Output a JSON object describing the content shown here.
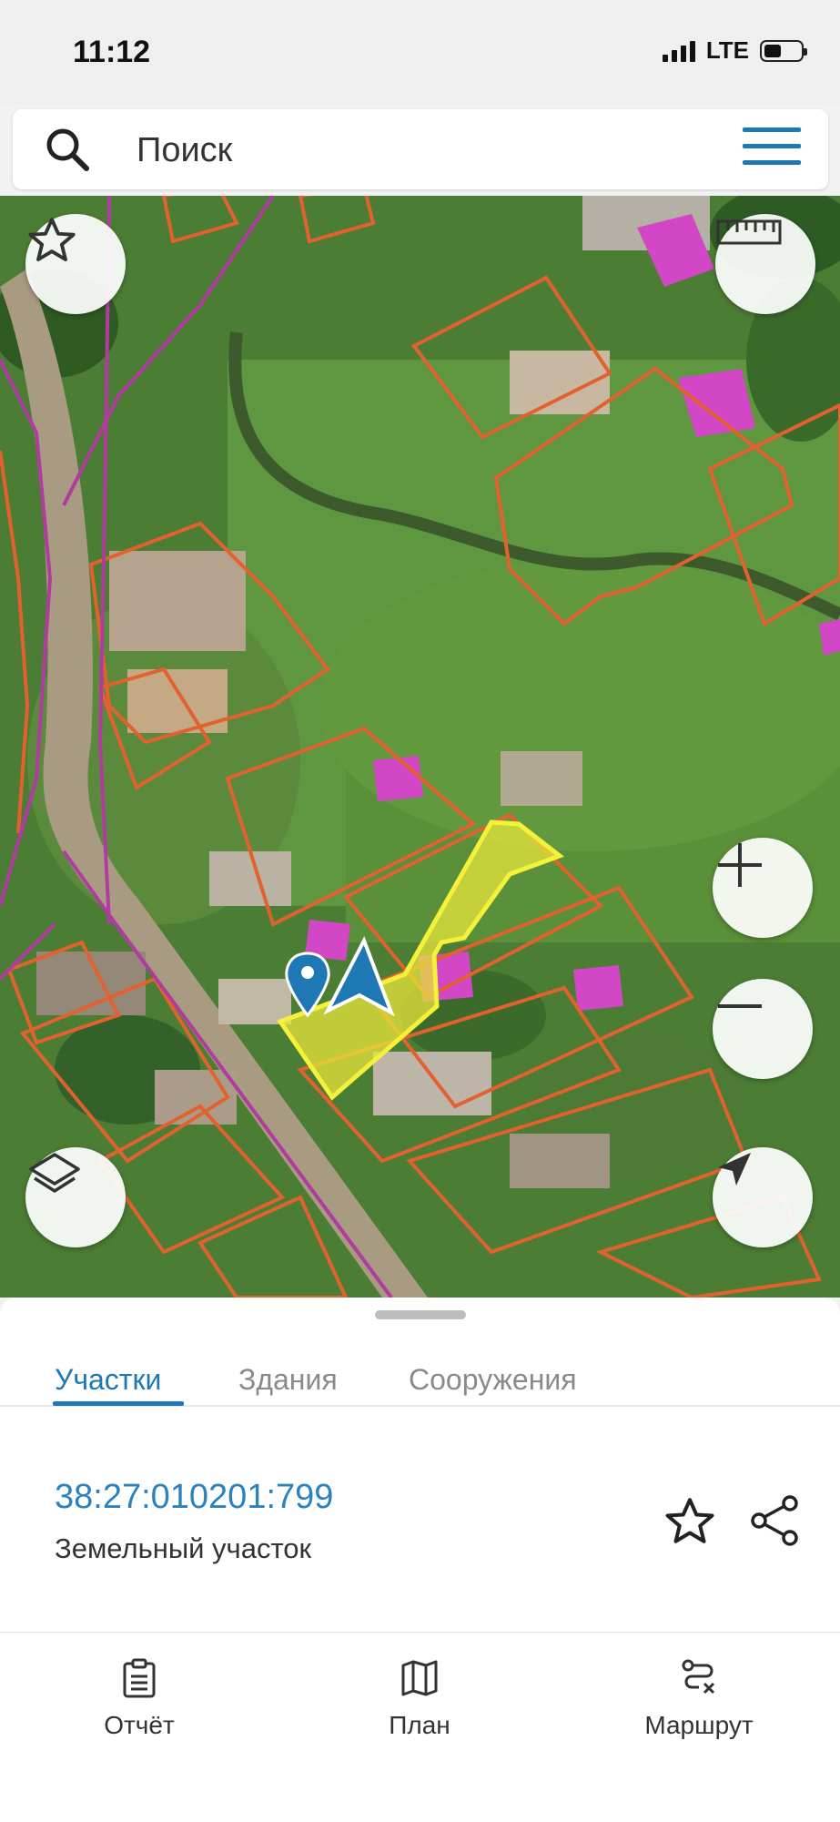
{
  "status": {
    "time": "11:12",
    "network": "LTE"
  },
  "search": {
    "placeholder": "Поиск"
  },
  "map": {
    "controls": [
      "star-icon",
      "ruler-icon",
      "layers-icon",
      "zoom-in-icon",
      "zoom-out-icon",
      "locate-icon"
    ]
  },
  "sheet": {
    "tabs": [
      {
        "label": "Участки",
        "active": true
      },
      {
        "label": "Здания",
        "active": false
      },
      {
        "label": "Сооружения",
        "active": false
      }
    ],
    "parcel": {
      "number": "38:27:010201:799",
      "type": "Земельный участок"
    }
  },
  "bottom_nav": [
    {
      "label": "Отчёт",
      "icon": "report-icon"
    },
    {
      "label": "План",
      "icon": "map-icon"
    },
    {
      "label": "Маршрут",
      "icon": "route-icon"
    }
  ],
  "colors": {
    "accent": "#1e78b4",
    "parcel_border": "#e2622f",
    "highlight": "#e8e53a",
    "boundary_line": "#b03ca0"
  }
}
